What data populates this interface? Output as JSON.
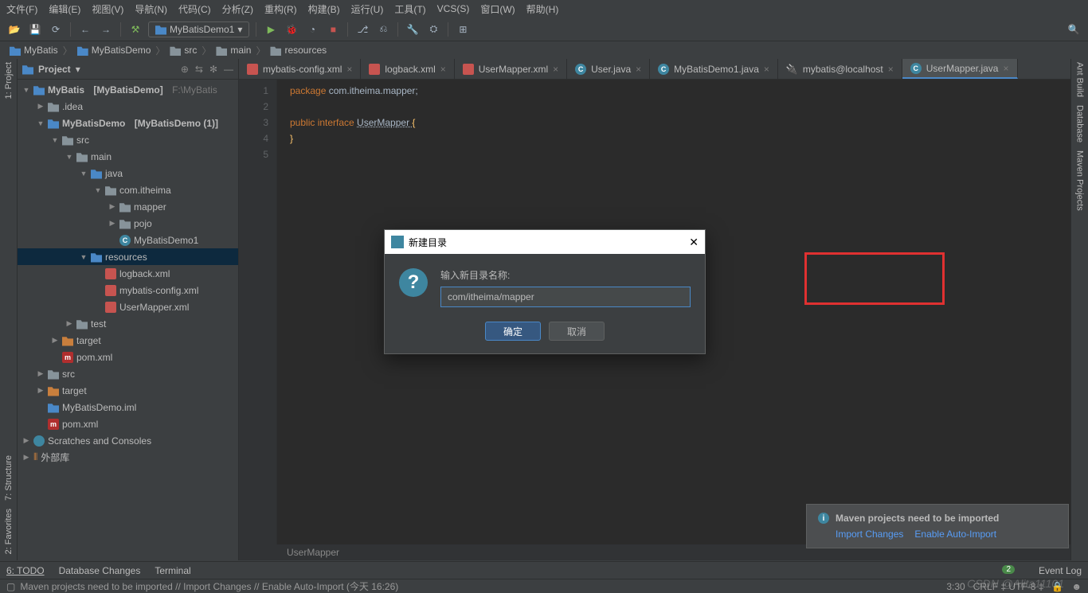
{
  "menu": [
    "文件(F)",
    "编辑(E)",
    "视图(V)",
    "导航(N)",
    "代码(C)",
    "分析(Z)",
    "重构(R)",
    "构建(B)",
    "运行(U)",
    "工具(T)",
    "VCS(S)",
    "窗口(W)",
    "帮助(H)"
  ],
  "runConfig": "MyBatisDemo1",
  "breadcrumbs": [
    "MyBatis",
    "MyBatisDemo",
    "src",
    "main",
    "resources"
  ],
  "sidebar": {
    "title": "Project",
    "tree": {
      "root": "MyBatis",
      "rootBold": "[MyBatisDemo]",
      "rootPath": "F:\\MyBatis",
      "idea": ".idea",
      "demo": "MyBatisDemo",
      "demoBold": "[MyBatisDemo (1)]",
      "src": "src",
      "main": "main",
      "java": "java",
      "pkg": "com.itheima",
      "mapper": "mapper",
      "pojo": "pojo",
      "c1": "MyBatisDemo1",
      "res": "resources",
      "f1": "logback.xml",
      "f2": "mybatis-config.xml",
      "f3": "UserMapper.xml",
      "test": "test",
      "target1": "target",
      "pom1": "pom.xml",
      "src2": "src",
      "target2": "target",
      "iml": "MyBatisDemo.iml",
      "pom2": "pom.xml",
      "scratch": "Scratches and Consoles",
      "ext": "外部库"
    }
  },
  "tabs": [
    {
      "name": "mybatis-config.xml",
      "kind": "xml"
    },
    {
      "name": "logback.xml",
      "kind": "xml"
    },
    {
      "name": "UserMapper.xml",
      "kind": "xml"
    },
    {
      "name": "User.java",
      "kind": "class"
    },
    {
      "name": "MyBatisDemo1.java",
      "kind": "class"
    },
    {
      "name": "mybatis@localhost",
      "kind": "db"
    },
    {
      "name": "UserMapper.java",
      "kind": "class",
      "active": true
    }
  ],
  "code": {
    "l1a": "package ",
    "l1b": "com.itheima.mapper;",
    "l3a": "public interface ",
    "l3b": "UserMapper ",
    "l3c": "{",
    "l4": "}"
  },
  "dialog": {
    "title": "新建目录",
    "label": "输入新目录名称:",
    "value": "com/itheima/mapper",
    "ok": "确定",
    "cancel": "取消"
  },
  "notif": {
    "title": "Maven projects need to be imported",
    "link1": "Import Changes",
    "link2": "Enable Auto-Import"
  },
  "gutters": {
    "project": "1: Project",
    "structure": "7: Structure",
    "favorites": "2: Favorites",
    "ant": "Ant Build",
    "db": "Database",
    "maven": "Maven Projects"
  },
  "bottools": {
    "todo": "6: TODO",
    "dbc": "Database Changes",
    "term": "Terminal",
    "evlog": "Event Log"
  },
  "status": {
    "msg": "Maven projects need to be imported // Import Changes // Enable Auto-Import (今天 16:26)",
    "pos": "3:30",
    "enc": "CRLF ‡  UTF-8 ‡"
  },
  "breadcrumbBar": "UserMapper",
  "watermark": "CSDN @Alita11101"
}
